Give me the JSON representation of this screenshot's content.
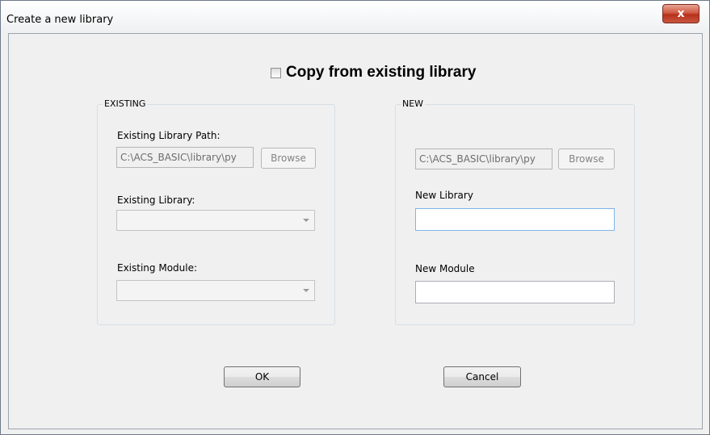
{
  "window": {
    "title": "Create a new library",
    "close_glyph": "x"
  },
  "copy_option": {
    "label": "Copy from existing library",
    "checked": false
  },
  "existing": {
    "group_label": "EXISTING",
    "path_label": "Existing Library Path:",
    "path_value": "C:\\ACS_BASIC\\library\\py",
    "browse_label": "Browse",
    "library_label": "Existing Library:",
    "library_value": "",
    "module_label": "Existing Module:",
    "module_value": ""
  },
  "new": {
    "group_label": "NEW",
    "path_value": "C:\\ACS_BASIC\\library\\py",
    "browse_label": "Browse",
    "library_label": "New Library",
    "library_value": "",
    "module_label": "New Module",
    "module_value": ""
  },
  "buttons": {
    "ok_label": "OK",
    "cancel_label": "Cancel"
  }
}
